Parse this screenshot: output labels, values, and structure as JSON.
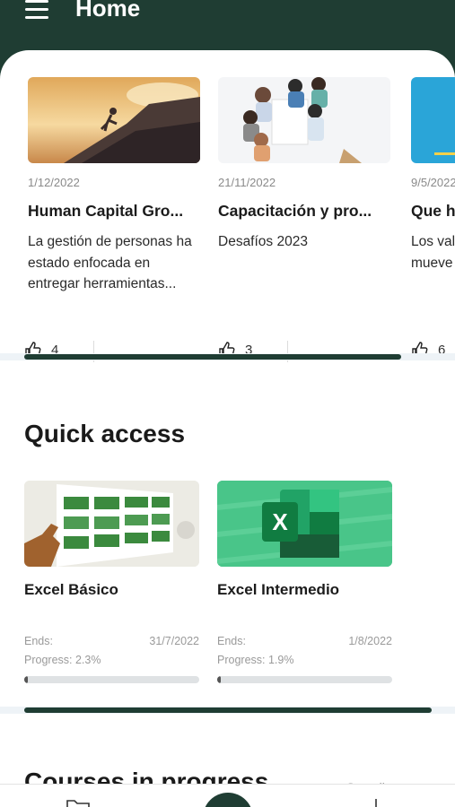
{
  "header": {
    "title": "Home"
  },
  "news": [
    {
      "date": "1/12/2022",
      "title": "Human Capital Gro...",
      "desc": "La gestión de personas ha estado enfocada en entregar herramientas...",
      "likes": "4"
    },
    {
      "date": "21/11/2022",
      "title": "Capacitación y pro...",
      "desc": "Desafíos 2023",
      "likes": "3"
    },
    {
      "date": "9/5/2022",
      "title": "Que h",
      "desc": "Los val mueve",
      "likes": "6"
    }
  ],
  "news_scroll": {
    "thumb_fraction": 0.83
  },
  "quick_access": {
    "title": "Quick access",
    "ends_label": "Ends:",
    "courses": [
      {
        "name": "Excel Básico",
        "ends": "31/7/2022",
        "progress_text": "Progress: 2.3%",
        "progress": 2.3
      },
      {
        "name": "Excel Intermedio",
        "ends": "1/8/2022",
        "progress_text": "Progress: 1.9%",
        "progress": 1.9
      }
    ]
  },
  "courses_in_progress": {
    "title": "Courses in progress",
    "see_all": "See all"
  },
  "colors": {
    "brand": "#1f3d33",
    "accent_green": "#3fbf7f"
  }
}
